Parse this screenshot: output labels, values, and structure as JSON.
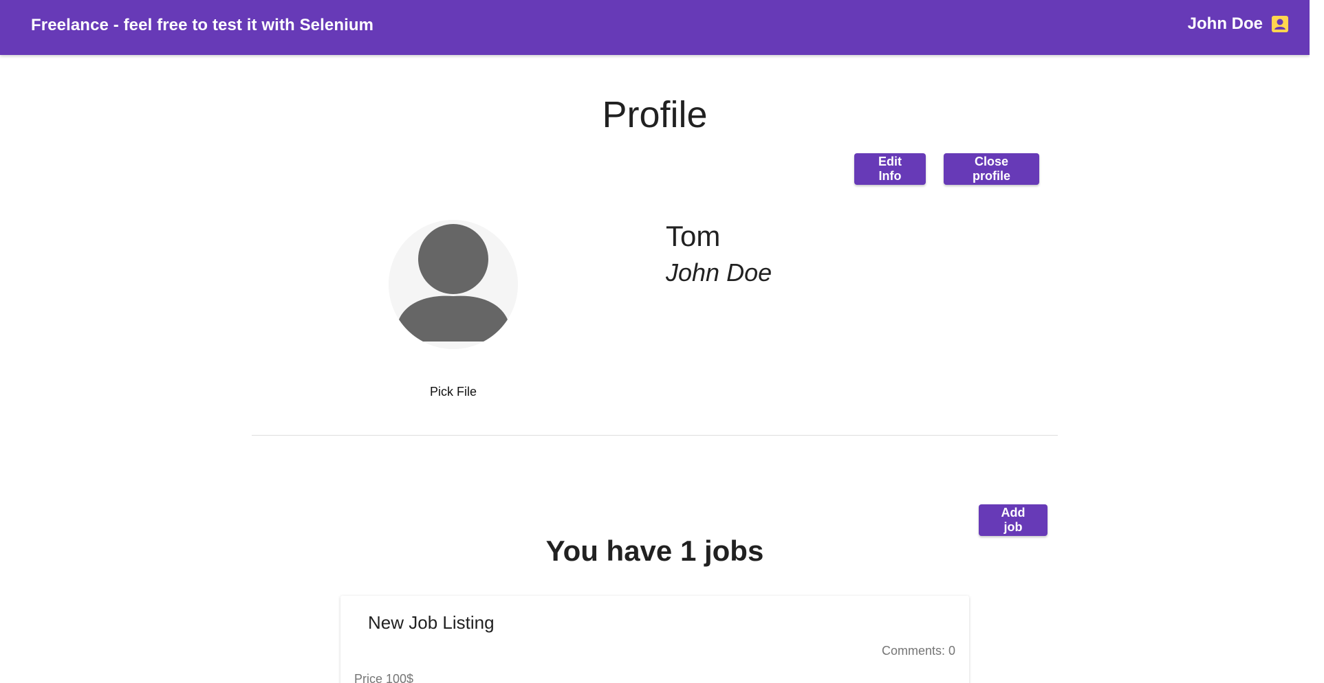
{
  "header": {
    "brand": "Freelance - feel free to test it with Selenium",
    "user_name": "John Doe",
    "user_icon": "account-box-icon"
  },
  "profile": {
    "title": "Profile",
    "edit_button": "Edit Info",
    "close_button": "Close profile",
    "avatar_icon": "user-avatar-icon",
    "pick_file": "Pick File",
    "name": "Tom",
    "full_name": "John Doe"
  },
  "jobs": {
    "add_button": "Add job",
    "summary": "You have 1 jobs",
    "items": [
      {
        "title": "New Job Listing",
        "comments": "Comments: 0",
        "price": "Price 100$"
      }
    ]
  },
  "colors": {
    "primary": "#673ab7",
    "header_text": "#ffffff",
    "user_icon": "#ffd54f",
    "avatar_background": "#f5f5f5",
    "avatar_figure": "#666666"
  }
}
